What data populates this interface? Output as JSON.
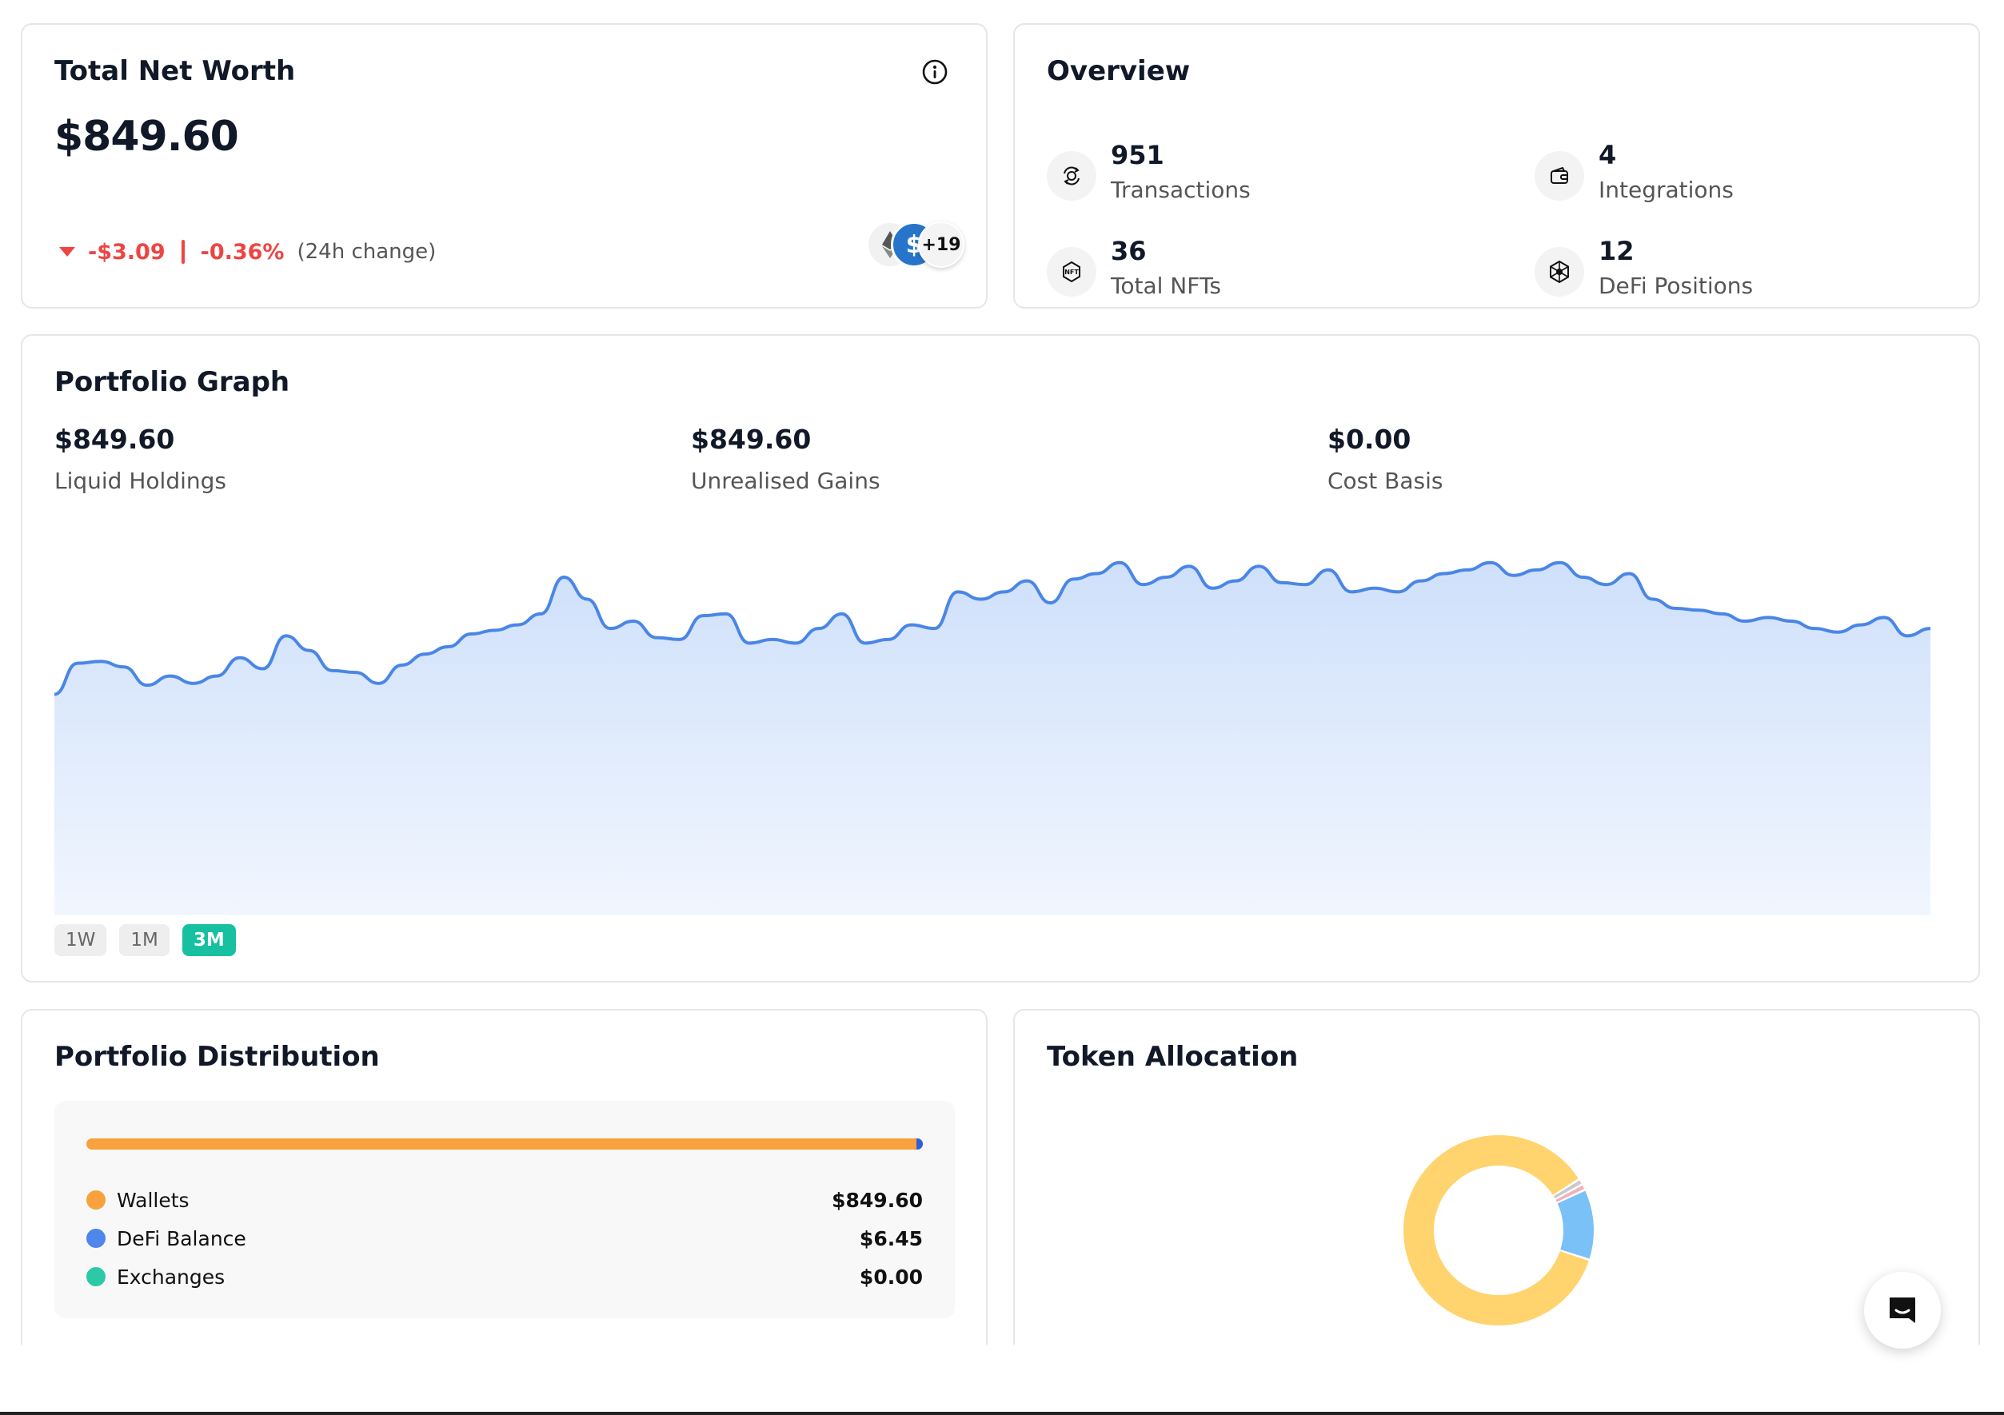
{
  "net_worth": {
    "title": "Total Net Worth",
    "value": "$849.60",
    "change_abs": "-$3.09",
    "change_pct": "-0.36%",
    "change_label": "(24h change)",
    "more_tokens": "+19"
  },
  "overview": {
    "title": "Overview",
    "stats": [
      {
        "value": "951",
        "label": "Transactions",
        "icon": "transactions-icon"
      },
      {
        "value": "4",
        "label": "Integrations",
        "icon": "wallet-icon"
      },
      {
        "value": "36",
        "label": "Total NFTs",
        "icon": "nft-icon"
      },
      {
        "value": "12",
        "label": "DeFi Positions",
        "icon": "defi-network-icon"
      }
    ]
  },
  "portfolio_graph": {
    "title": "Portfolio Graph",
    "stats": [
      {
        "value": "$849.60",
        "label": "Liquid Holdings"
      },
      {
        "value": "$849.60",
        "label": "Unrealised Gains"
      },
      {
        "value": "$0.00",
        "label": "Cost Basis"
      }
    ],
    "ranges": [
      "1W",
      "1M",
      "3M"
    ],
    "active_range": "3M",
    "series": [
      812,
      829,
      830,
      827,
      817,
      822,
      818,
      822,
      832,
      826,
      844,
      836,
      825,
      824,
      818,
      828,
      834,
      838,
      845,
      847,
      850,
      856,
      876,
      864,
      848,
      852,
      843,
      842,
      855,
      856,
      840,
      842,
      840,
      848,
      856,
      840,
      842,
      850,
      848,
      868,
      864,
      868,
      874,
      862,
      875,
      878,
      884,
      872,
      876,
      882,
      870,
      874,
      882,
      873,
      872,
      880,
      868,
      870,
      868,
      874,
      878,
      880,
      884,
      877,
      880,
      884,
      876,
      872,
      878,
      864,
      859,
      858,
      856,
      852,
      854,
      852,
      848,
      846,
      850,
      854,
      844,
      848
    ]
  },
  "distribution": {
    "title": "Portfolio Distribution",
    "wallets_share": 0.992,
    "items": [
      {
        "name": "Wallets",
        "value": "$849.60",
        "color": "#f7a23e"
      },
      {
        "name": "DeFi Balance",
        "value": "$6.45",
        "color": "#4f86ec"
      },
      {
        "name": "Exchanges",
        "value": "$0.00",
        "color": "#2cc9a6"
      }
    ]
  },
  "token_allocation": {
    "title": "Token Allocation",
    "slices": [
      {
        "share": 0.86,
        "color": "#ffd36e"
      },
      {
        "share": 0.01,
        "color": "#c9c9c9"
      },
      {
        "share": 0.01,
        "color": "#f0b0bb"
      },
      {
        "share": 0.12,
        "color": "#79c1f7"
      }
    ]
  }
}
